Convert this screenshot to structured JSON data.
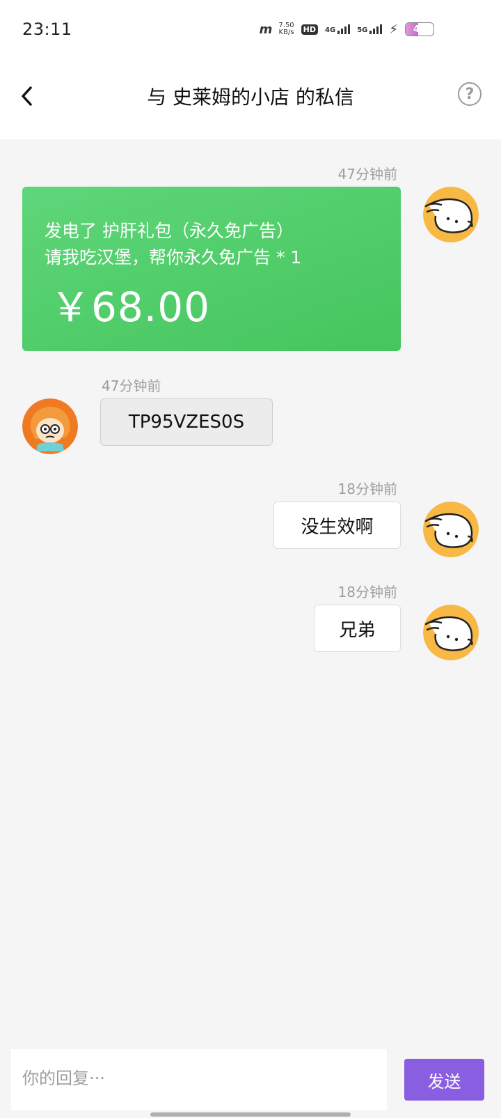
{
  "status_bar": {
    "time": "23:11",
    "net_speed_value": "7.50",
    "net_speed_unit": "KB/s",
    "hd_label": "HD",
    "sim1_label": "4G",
    "sim2_label": "5G",
    "battery_level": "46",
    "battery_fraction": 0.46
  },
  "header": {
    "title": "与 史莱姆的小店 的私信",
    "back_icon": "chevron-left-icon",
    "help_icon": "help-circle-icon",
    "help_glyph": "?"
  },
  "messages": [
    {
      "type": "gift",
      "side": "right",
      "time": "47分钟前",
      "line1": "发电了 护肝礼包（永久免广告）",
      "line2": "请我吃汉堡，帮你永久免广告 * 1",
      "amount": "￥68.00"
    },
    {
      "type": "text",
      "side": "left",
      "time": "47分钟前",
      "text": "TP95VZES0S"
    },
    {
      "type": "text",
      "side": "right",
      "time": "18分钟前",
      "text": "没生效啊"
    },
    {
      "type": "text",
      "side": "right",
      "time": "18分钟前",
      "text": "兄弟"
    }
  ],
  "composer": {
    "placeholder": "你的回复···",
    "send_label": "发送"
  },
  "colors": {
    "gift_green": "#4cca64",
    "send_purple": "#8a5ee0",
    "avatar_yellow": "#f7b844",
    "avatar_orange": "#f07a22"
  }
}
